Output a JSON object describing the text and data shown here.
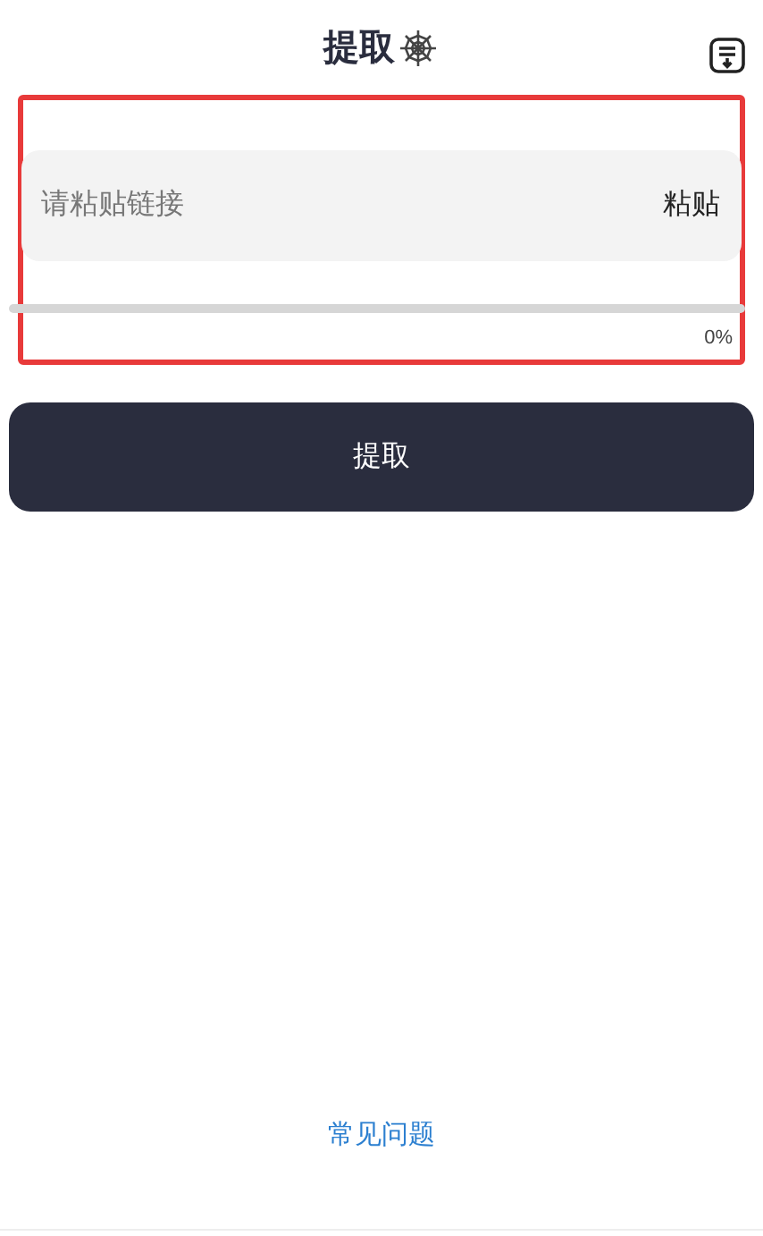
{
  "header": {
    "title": "提取"
  },
  "link_input": {
    "placeholder": "请粘贴链接",
    "paste_label": "粘贴"
  },
  "progress": {
    "level": 0,
    "reading": "0%"
  },
  "extract_button": {
    "label": "提取"
  },
  "faq_link": {
    "label": "常见问题"
  }
}
